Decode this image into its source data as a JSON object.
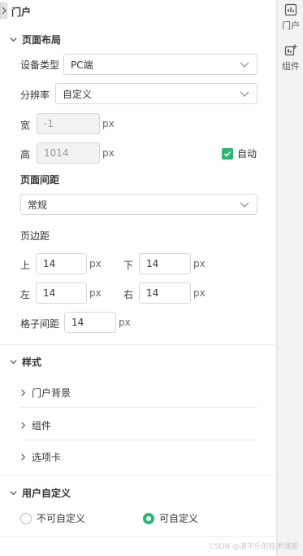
{
  "header": {
    "title": "门户"
  },
  "layout_section": {
    "title": "页面布局",
    "device_label": "设备类型",
    "device_value": "PC端",
    "resolution_label": "分辨率",
    "resolution_value": "自定义",
    "width_label": "宽",
    "width_value": "-1",
    "height_label": "高",
    "height_value": "1014",
    "unit": "px",
    "auto_label": "自动",
    "auto_checked": true
  },
  "spacing_section": {
    "title": "页面间距",
    "spacing_value": "常规",
    "margin_title": "页边距",
    "top_label": "上",
    "top_value": "14",
    "bottom_label": "下",
    "bottom_value": "14",
    "left_label": "左",
    "left_value": "14",
    "right_label": "右",
    "right_value": "14",
    "gap_label": "格子间距",
    "gap_value": "14",
    "unit": "px"
  },
  "style_section": {
    "title": "样式",
    "items": [
      {
        "label": "门户背景"
      },
      {
        "label": "组件"
      },
      {
        "label": "选项卡"
      }
    ]
  },
  "custom_section": {
    "title": "用户自定义",
    "options": [
      {
        "label": "不可自定义",
        "selected": false
      },
      {
        "label": "可自定义",
        "selected": true
      }
    ]
  },
  "sidebar": {
    "items": [
      {
        "label": "门户",
        "icon": "chart-icon"
      },
      {
        "label": "组件",
        "icon": "add-component-icon"
      }
    ]
  },
  "watermark": "CSDN @清平乐的技术博客",
  "colors": {
    "accent": "#2bb673"
  }
}
